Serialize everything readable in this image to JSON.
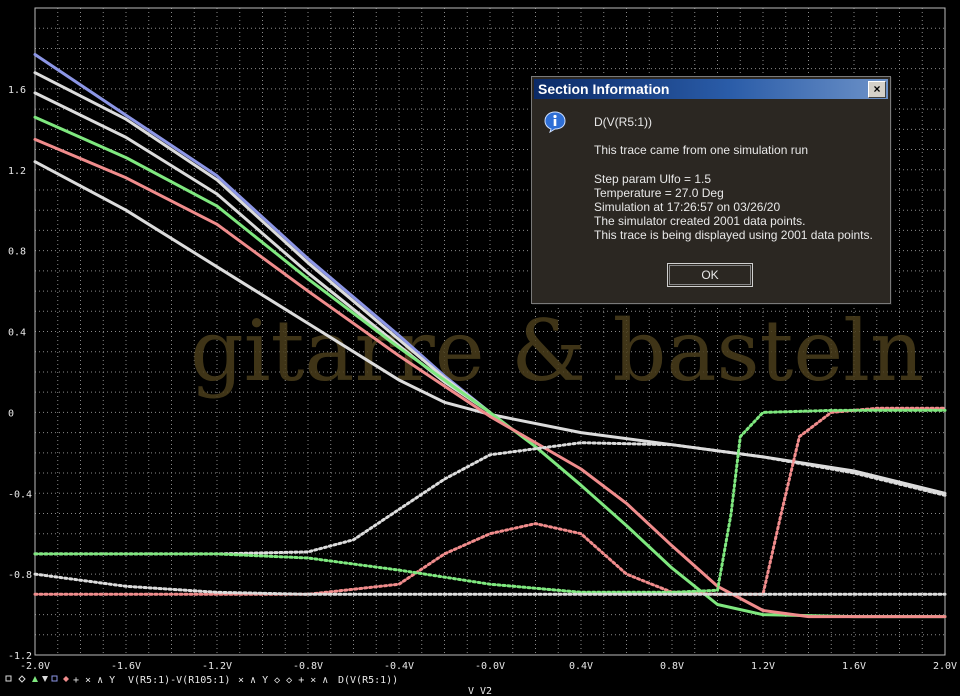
{
  "chart_data": {
    "type": "line",
    "xlabel": "V_V2",
    "xlim": [
      -2.0,
      2.0
    ],
    "ylim": [
      -1.2,
      2.0
    ],
    "grid": true,
    "x_ticks": [
      -2.0,
      -1.6,
      -1.2,
      -0.8,
      -0.4,
      0.0,
      0.4,
      0.8,
      1.2,
      1.6,
      2.0
    ],
    "x_tick_labels": [
      "-2.0V",
      "-1.6V",
      "-1.2V",
      "-0.8V",
      "-0.4V",
      "-0.0V",
      "0.4V",
      "0.8V",
      "1.2V",
      "1.6V",
      "2.0V"
    ],
    "y_ticks": [
      -1.2,
      -0.8,
      -0.4,
      0,
      0.4,
      0.8,
      1.2,
      1.6
    ],
    "y_tick_labels": [
      "-1.2",
      "-0.8",
      "-0.4",
      "0",
      "0.4",
      "0.8",
      "1.2",
      "1.6"
    ],
    "legend": [
      "V(R5:1)-V(R105:1)",
      "D(V(R5:1))"
    ],
    "series": [
      {
        "color": "#8c96e6",
        "style": "solid",
        "x": [
          -2.0,
          -1.6,
          -1.2,
          -0.8,
          -0.4,
          -0.2,
          0.0
        ],
        "y": [
          1.77,
          1.47,
          1.17,
          0.76,
          0.38,
          0.18,
          0.0
        ]
      },
      {
        "color": "#dcdcdc",
        "style": "solid",
        "x": [
          -2.0,
          -1.6,
          -1.2,
          -0.8,
          -0.4,
          -0.2,
          0.0
        ],
        "y": [
          1.68,
          1.45,
          1.15,
          0.74,
          0.36,
          0.17,
          0.0
        ]
      },
      {
        "color": "#dcdcdc",
        "style": "solid",
        "x": [
          -2.0,
          -1.6,
          -1.2,
          -0.8,
          -0.4,
          -0.2,
          0.0
        ],
        "y": [
          1.58,
          1.36,
          1.08,
          0.69,
          0.33,
          0.15,
          0.0
        ]
      },
      {
        "color": "#dcdcdc",
        "style": "solid",
        "x": [
          -2.0,
          -1.6,
          -1.2,
          -0.8,
          -0.4,
          -0.2,
          0.0,
          0.4,
          0.8,
          1.2,
          1.6,
          2.0
        ],
        "y": [
          1.24,
          1.0,
          0.72,
          0.44,
          0.16,
          0.05,
          -0.01,
          -0.1,
          -0.16,
          -0.22,
          -0.29,
          -0.4
        ]
      },
      {
        "color": "#7fe87f",
        "style": "solid",
        "x": [
          -2.0,
          -1.6,
          -1.2,
          -0.8,
          -0.4,
          0.0,
          0.2,
          0.4,
          0.6,
          0.8,
          1.0,
          1.2,
          1.6,
          2.0
        ],
        "y": [
          1.46,
          1.26,
          1.02,
          0.66,
          0.32,
          0.0,
          -0.17,
          -0.36,
          -0.56,
          -0.77,
          -0.95,
          -1.0,
          -1.01,
          -1.01
        ]
      },
      {
        "color": "#f08c8c",
        "style": "solid",
        "x": [
          -2.0,
          -1.6,
          -1.2,
          -0.8,
          -0.4,
          0.0,
          0.4,
          0.6,
          0.8,
          1.0,
          1.2,
          1.4,
          1.6,
          2.0
        ],
        "y": [
          1.35,
          1.16,
          0.93,
          0.6,
          0.28,
          -0.02,
          -0.28,
          -0.45,
          -0.66,
          -0.86,
          -0.98,
          -1.01,
          -1.01,
          -1.01
        ]
      },
      {
        "color": "#dcdcdc",
        "style": "dotted",
        "x": [
          -2.0,
          -1.2,
          -0.8,
          -0.6,
          -0.4,
          -0.2,
          0.0,
          0.4,
          0.8,
          1.2,
          1.6,
          2.0
        ],
        "y": [
          -0.7,
          -0.7,
          -0.69,
          -0.63,
          -0.48,
          -0.33,
          -0.21,
          -0.15,
          -0.16,
          -0.22,
          -0.3,
          -0.41
        ]
      },
      {
        "color": "#f08c8c",
        "style": "dotted",
        "x": [
          -2.0,
          -0.8,
          -0.4,
          -0.2,
          0.0,
          0.2,
          0.4,
          0.6,
          0.8,
          1.0,
          1.2,
          1.28,
          1.36,
          1.5,
          1.7,
          2.0
        ],
        "y": [
          -0.9,
          -0.9,
          -0.85,
          -0.7,
          -0.6,
          -0.55,
          -0.6,
          -0.8,
          -0.89,
          -0.9,
          -0.9,
          -0.5,
          -0.12,
          0.0,
          0.02,
          0.02
        ]
      },
      {
        "color": "#7fe87f",
        "style": "dotted",
        "x": [
          -2.0,
          -1.2,
          -0.8,
          -0.4,
          0.0,
          0.4,
          0.8,
          1.0,
          1.06,
          1.1,
          1.2,
          1.5,
          2.0
        ],
        "y": [
          -0.7,
          -0.7,
          -0.72,
          -0.78,
          -0.85,
          -0.89,
          -0.89,
          -0.88,
          -0.5,
          -0.12,
          0.0,
          0.01,
          0.01
        ]
      },
      {
        "color": "#dcdcdc",
        "style": "dotted",
        "x": [
          -2.0,
          -1.6,
          -1.2,
          -0.8,
          -0.4,
          0.0,
          0.4,
          0.8,
          1.2,
          1.6,
          2.0
        ],
        "y": [
          -0.8,
          -0.86,
          -0.89,
          -0.9,
          -0.9,
          -0.9,
          -0.9,
          -0.9,
          -0.9,
          -0.9,
          -0.9
        ]
      }
    ]
  },
  "watermark": "gitarre & basteln",
  "dialog": {
    "title": "Section Information",
    "close_label": "×",
    "trace_name": "D(V(R5:1))",
    "line_run": "This trace came from one simulation run",
    "line_step": "Step param Ulfo  =     1.5",
    "line_temp": "Temperature  = 27.0 Deg",
    "line_sim": "Simulation at 17:26:57 on 03/26/20",
    "line_created": "The simulator created 2001 data points.",
    "line_displayed": "This trace is being displayed using 2001 data points.",
    "ok_label": "OK",
    "icon": "info-icon"
  }
}
